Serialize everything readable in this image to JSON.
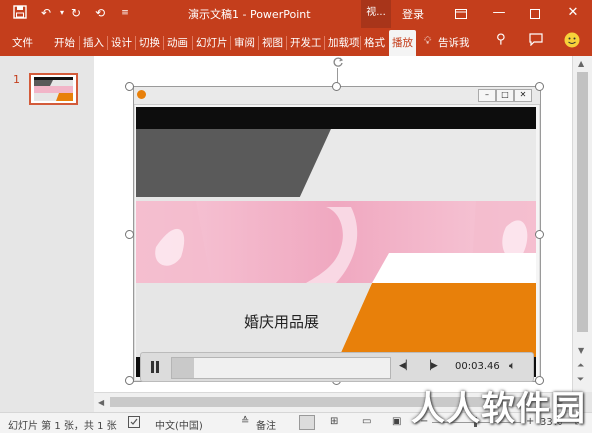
{
  "window": {
    "title": "演示文稿1  -  PowerPoint",
    "context_tab": "视...",
    "login": "登录"
  },
  "quick_access": {
    "icons": [
      "save-icon",
      "undo-icon",
      "redo-icon",
      "repeat-icon",
      "customize-icon"
    ]
  },
  "ribbon": {
    "tabs": [
      "文件",
      "开始",
      "插入",
      "设计",
      "切换",
      "动画",
      "幻灯片",
      "审阅",
      "视图",
      "开发工",
      "加载项",
      "格式",
      "播放"
    ],
    "active_tab": "播放",
    "tell_me": "告诉我"
  },
  "thumbnails": [
    {
      "number": "1"
    }
  ],
  "slide": {
    "title_text": "婚庆用品展"
  },
  "media_player": {
    "time": "00:03.46",
    "progress": 0.1
  },
  "statusbar": {
    "slide_info": "幻灯片 第 1 张，共 1 张",
    "language": "中文(中国)",
    "notes": "备注",
    "zoom": "33%"
  },
  "watermark": {
    "text": "人人软件园"
  },
  "colors": {
    "accent": "#c43e1c",
    "orange": "#e8800a",
    "pink": "#f2b5c8",
    "dark_gray": "#5a5a5a"
  }
}
